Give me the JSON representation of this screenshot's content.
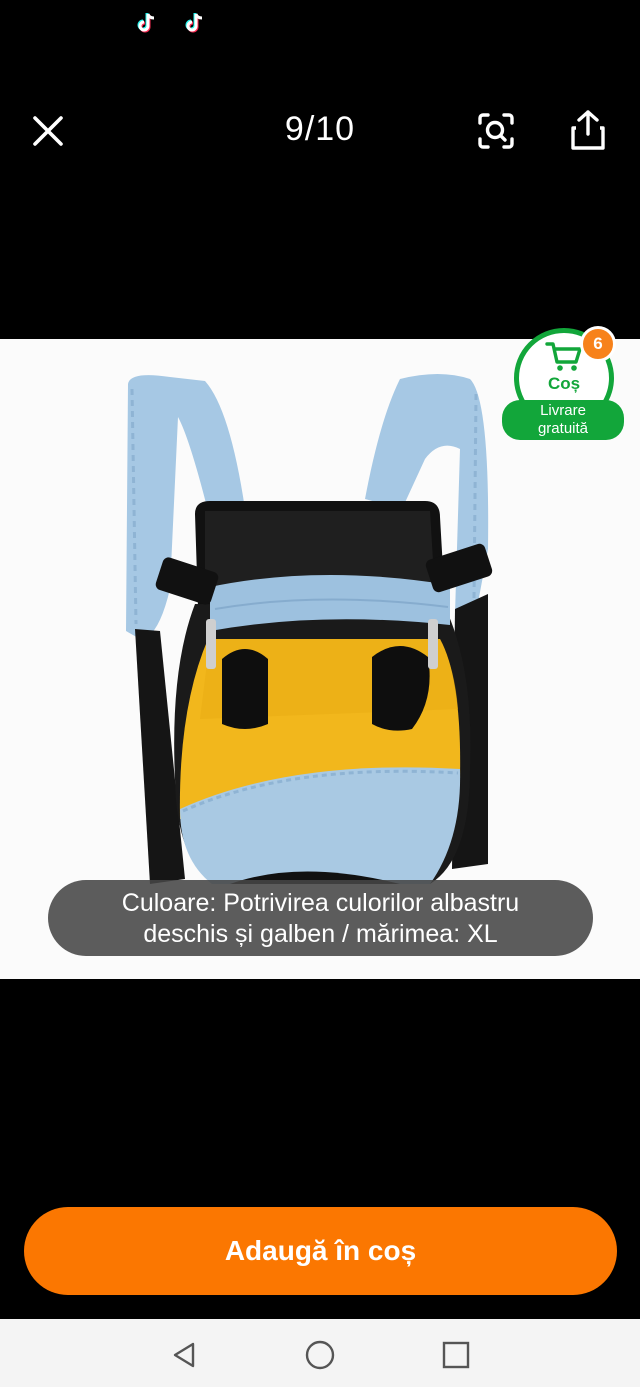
{
  "status_bar": {
    "icons": [
      "tiktok-icon",
      "tiktok-icon"
    ]
  },
  "topbar": {
    "counter": "9/10",
    "close_icon": "close-icon",
    "lens_icon": "image-search-icon",
    "share_icon": "share-icon"
  },
  "cart_badge": {
    "count": "6",
    "label": "Coș",
    "free_shipping_line1": "Livrare",
    "free_shipping_line2": "gratuită",
    "color": "#12a63a",
    "count_color": "#f7821b"
  },
  "caption": {
    "line1": "Culoare: Potrivirea culorilor albastru",
    "line2": "deschis și galben / mărimea: XL"
  },
  "cta": {
    "add_to_cart": "Adaugă în coș",
    "color": "#fb7701"
  },
  "navbar": {
    "icons": [
      "back-icon",
      "home-icon",
      "recents-icon"
    ]
  }
}
